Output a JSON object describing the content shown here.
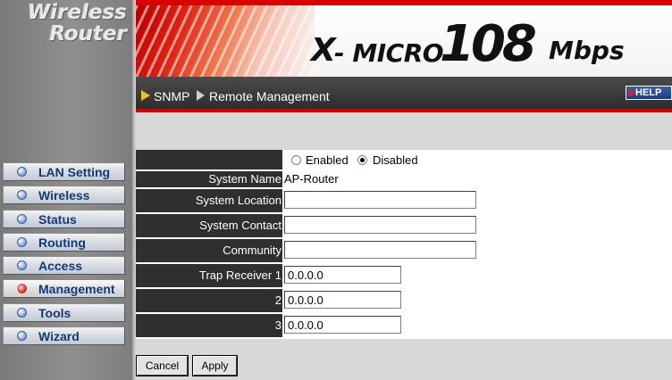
{
  "logo": {
    "line1": "Wireless",
    "line2": "Router"
  },
  "banner": {
    "brand_x": "X",
    "brand_name": "- MICRO",
    "brand_speed": "108",
    "brand_unit": "Mbps"
  },
  "breadcrumb": {
    "item1": "SNMP",
    "item2": "Remote Management"
  },
  "help_label": "HELP",
  "sidebar": {
    "items": [
      {
        "label": "LAN Setting",
        "active": false
      },
      {
        "label": "Wireless",
        "active": false
      },
      {
        "label": "Status",
        "active": false
      },
      {
        "label": "Routing",
        "active": false
      },
      {
        "label": "Access",
        "active": false
      },
      {
        "label": "Management",
        "active": true
      },
      {
        "label": "Tools",
        "active": false
      },
      {
        "label": "Wizard",
        "active": false
      }
    ]
  },
  "form": {
    "snmp_enabled_label": "Enabled",
    "snmp_disabled_label": "Disabled",
    "snmp_state": "Disabled",
    "system_name_label": "System Name",
    "system_name_value": "AP-Router",
    "system_location_label": "System Location",
    "system_location_value": "",
    "system_contact_label": "System Contact",
    "system_contact_value": "",
    "community_label": "Community",
    "community_value": "",
    "trap_receiver_1_label": "Trap Receiver 1",
    "trap_receiver_1_value": "0.0.0.0",
    "trap_receiver_2_label": "2",
    "trap_receiver_2_value": "0.0.0.0",
    "trap_receiver_3_label": "3",
    "trap_receiver_3_value": "0.0.0.0"
  },
  "buttons": {
    "cancel": "Cancel",
    "apply": "Apply"
  },
  "colors": {
    "accent_red": "#d60000",
    "nav_dark": "#2f2f2f",
    "menu_text": "#123a78"
  }
}
